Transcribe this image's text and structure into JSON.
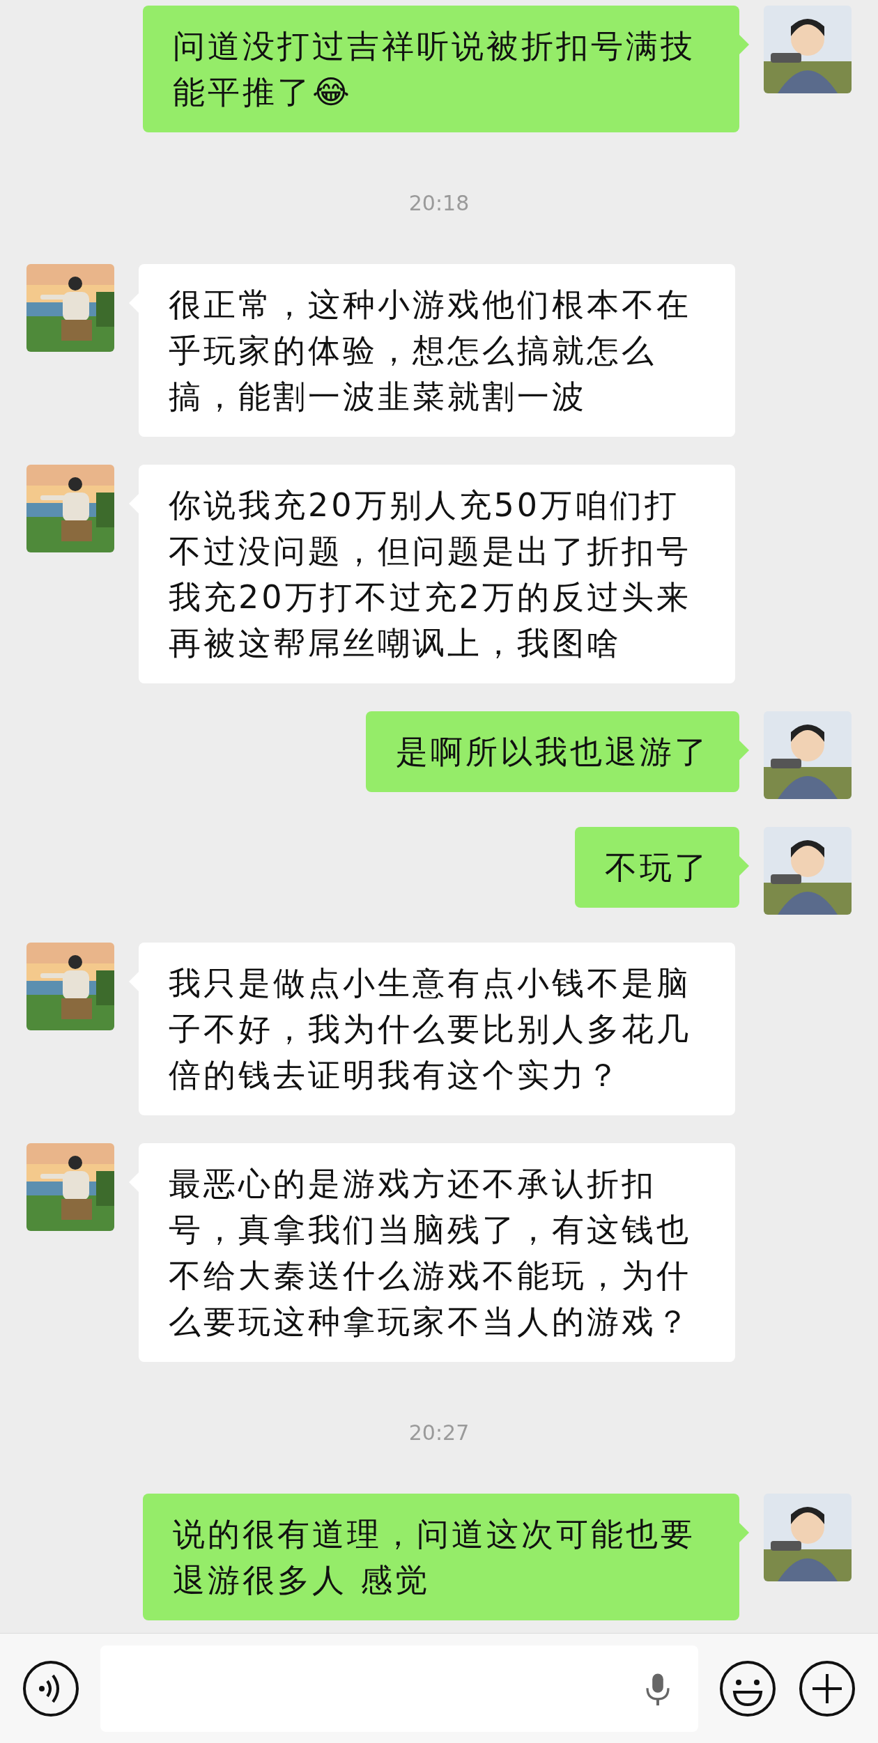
{
  "messages": [
    {
      "kind": "sent",
      "text": "问道没打过吉祥听说被折扣号满技能平推了😂"
    },
    {
      "kind": "time",
      "text": "20:18"
    },
    {
      "kind": "received",
      "text": "很正常，这种小游戏他们根本不在乎玩家的体验，想怎么搞就怎么搞，能割一波韭菜就割一波"
    },
    {
      "kind": "received",
      "text": "你说我充20万别人充50万咱们打不过没问题，但问题是出了折扣号我充20万打不过充2万的反过头来再被这帮屌丝嘲讽上，我图啥"
    },
    {
      "kind": "sent",
      "text": "是啊所以我也退游了"
    },
    {
      "kind": "sent",
      "text": "不玩了"
    },
    {
      "kind": "received",
      "text": "我只是做点小生意有点小钱不是脑子不好，我为什么要比别人多花几倍的钱去证明我有这个实力？"
    },
    {
      "kind": "received",
      "text": "最恶心的是游戏方还不承认折扣号，真拿我们当脑残了，有这钱也不给大秦送什么游戏不能玩，为什么要玩这种拿玩家不当人的游戏？"
    },
    {
      "kind": "time",
      "text": "20:27"
    },
    {
      "kind": "sent",
      "text": "说的很有道理，问道这次可能也要退游很多人 感觉"
    }
  ]
}
